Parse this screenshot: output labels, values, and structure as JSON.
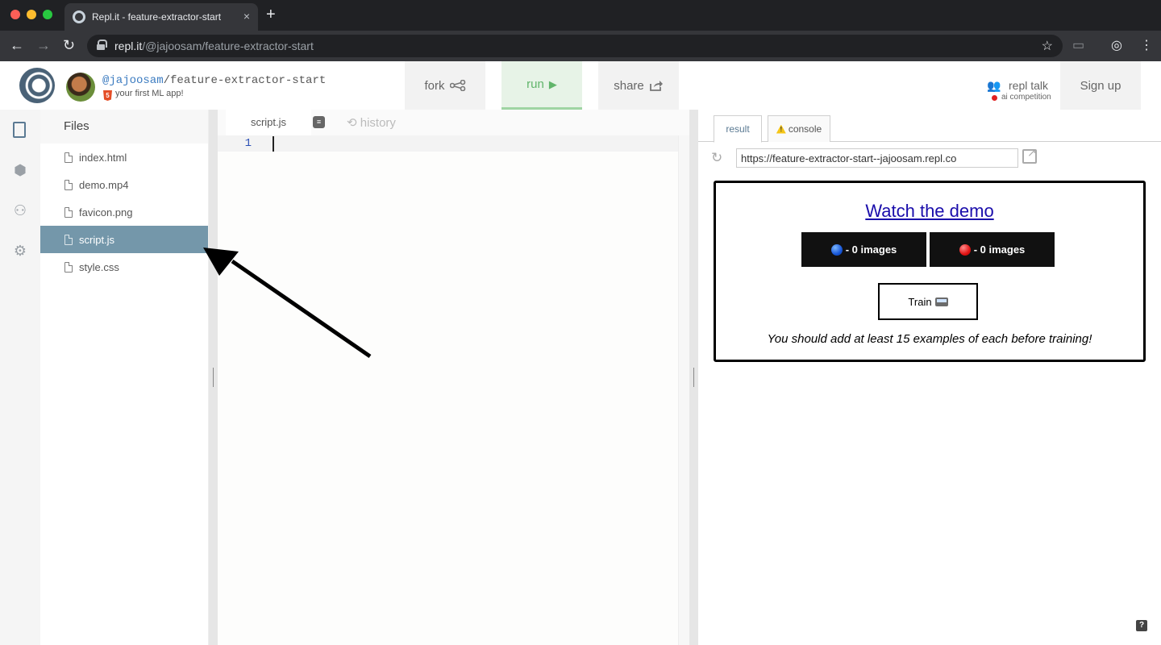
{
  "browser": {
    "tab_title": "Repl.it - feature-extractor-start",
    "tab_close": "×",
    "new_tab": "+",
    "url_host": "repl.it",
    "url_path": "/@jajoosam/feature-extractor-start",
    "nav_back": "←",
    "nav_forward": "→",
    "nav_reload": "↻",
    "star": "☆",
    "menu": "⋮",
    "colors": {
      "frame": "#202124",
      "toolbar": "#35363a"
    }
  },
  "header": {
    "owner": "@jajoosam",
    "separator": "/",
    "repl_name": "feature-extractor-start",
    "description": "your first ML app!",
    "language_icon": "html5-icon",
    "fork_label": "fork",
    "fork_icon": "⋖",
    "run_label": "run",
    "run_icon": "▶",
    "share_label": "share",
    "share_icon": "↪",
    "repl_talk_label": "repl talk",
    "competition_label": "ai competition",
    "signup_label": "Sign up",
    "colors": {
      "run_accent": "#61b56b",
      "active_file": "#7497aa"
    }
  },
  "sidebar": {
    "files_heading": "Files",
    "rail_icons": [
      "files-icon",
      "packages-icon",
      "multiplayer-icon",
      "settings-icon"
    ],
    "files": [
      {
        "name": "index.html",
        "active": false
      },
      {
        "name": "demo.mp4",
        "active": false
      },
      {
        "name": "favicon.png",
        "active": false
      },
      {
        "name": "script.js",
        "active": true
      },
      {
        "name": "style.css",
        "active": false
      }
    ]
  },
  "editor": {
    "active_tab": "script.js",
    "history_label": "history",
    "history_icon": "⟲",
    "line_number": "1",
    "code": ""
  },
  "preview": {
    "tab_result": "result",
    "tab_console": "console",
    "url": "https://feature-extractor-start--jajoosam.repl.co",
    "reload_icon": "↻",
    "demo_link": "Watch the demo",
    "class_blue_label": "- 0 images",
    "class_red_label": "- 0 images",
    "train_label": "Train",
    "train_note": "You should add at least 15 examples of each before training!",
    "help_badge": "?"
  }
}
